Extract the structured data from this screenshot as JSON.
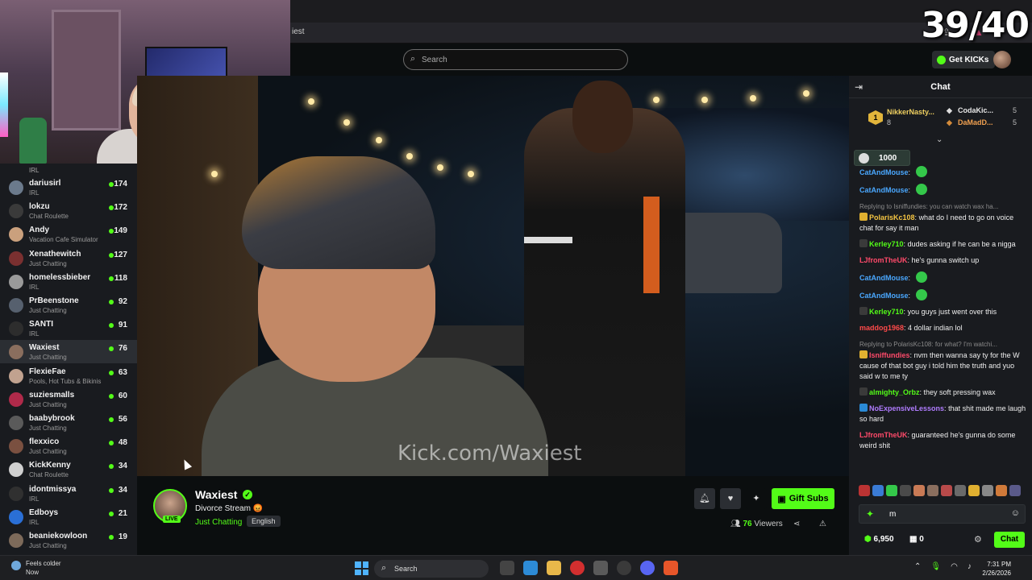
{
  "browser": {
    "address_text": "iest",
    "overlay_counter": "39/40"
  },
  "header": {
    "search_placeholder": "Search",
    "get_kicks_label": "Get KICKs"
  },
  "sidebar": {
    "top_partial_category": "IRL",
    "items": [
      {
        "name": "dariusirl",
        "category": "IRL",
        "viewers": "174",
        "avatar_color": "#6b7a8c"
      },
      {
        "name": "lokzu",
        "category": "Chat Roulette",
        "viewers": "172",
        "avatar_color": "#3a3a3a"
      },
      {
        "name": "Andy",
        "category": "Vacation Cafe Simulator",
        "viewers": "149",
        "avatar_color": "#caa07d"
      },
      {
        "name": "Xenathewitch",
        "category": "Just Chatting",
        "viewers": "127",
        "avatar_color": "#7a3030"
      },
      {
        "name": "homelessbieber",
        "category": "IRL",
        "viewers": "118",
        "avatar_color": "#9a9a9a"
      },
      {
        "name": "PrBeenstone",
        "category": "Just Chatting",
        "viewers": "92",
        "avatar_color": "#56606e"
      },
      {
        "name": "SANTI",
        "category": "IRL",
        "viewers": "91",
        "avatar_color": "#2d2d2d"
      },
      {
        "name": "Waxiest",
        "category": "Just Chatting",
        "viewers": "76",
        "avatar_color": "#8a6e5e",
        "active": true
      },
      {
        "name": "FlexieFae",
        "category": "Pools, Hot Tubs & Bikinis",
        "viewers": "63",
        "avatar_color": "#c1a28f"
      },
      {
        "name": "suziesmalls",
        "category": "Just Chatting",
        "viewers": "60",
        "avatar_color": "#b02a4a"
      },
      {
        "name": "baabybrook",
        "category": "Just Chatting",
        "viewers": "56",
        "avatar_color": "#5a5a5a"
      },
      {
        "name": "flexxico",
        "category": "Just Chatting",
        "viewers": "48",
        "avatar_color": "#7a5040"
      },
      {
        "name": "KickKenny",
        "category": "Chat Roulette",
        "viewers": "34",
        "avatar_color": "#d0d0d0"
      },
      {
        "name": "idontmissya",
        "category": "IRL",
        "viewers": "34",
        "avatar_color": "#303030"
      },
      {
        "name": "Edboys",
        "category": "IRL",
        "viewers": "21",
        "avatar_color": "#2a6fd6"
      },
      {
        "name": "beaniekowloon",
        "category": "Just Chatting",
        "viewers": "19",
        "avatar_color": "#7d6a5a"
      }
    ]
  },
  "video": {
    "watermark": "Kick.com/Waxiest"
  },
  "channel": {
    "name": "Waxiest",
    "live_badge": "LIVE",
    "stream_title": "Divorce Stream 😡",
    "category": "Just Chatting",
    "language": "English",
    "gift_subs_label": "Gift Subs",
    "viewer_count": "76",
    "viewers_label": "Viewers"
  },
  "chat": {
    "title": "Chat",
    "leaderboard": {
      "first": {
        "rank": "1",
        "name": "NikkerNasty...",
        "count": "8"
      },
      "second": {
        "name": "CodaKic...",
        "count": "5"
      },
      "third": {
        "name": "DaMadD...",
        "count": "5"
      }
    },
    "goal_value": "1000",
    "messages": [
      {
        "kind": "msg",
        "user": "CatAndMouse",
        "color": "#4aa8ff",
        "text": "",
        "emote": true
      },
      {
        "kind": "msg",
        "user": "CatAndMouse",
        "color": "#4aa8ff",
        "text": "",
        "emote": true
      },
      {
        "kind": "reply",
        "text": "Replying to Isniffundies: you can watch wax ha..."
      },
      {
        "kind": "msg",
        "user": "PolarisKc108",
        "color": "#f5c542",
        "text": "what do I need to go on voice chat for say it man",
        "badge": "#e0b030"
      },
      {
        "kind": "msg",
        "user": "Kerley710",
        "color": "#53fc18",
        "text": "dudes asking if he can be a nigga",
        "badge": "#3a3a3a"
      },
      {
        "kind": "msg",
        "user": "LJfromTheUK",
        "color": "#ff4a6a",
        "text": "he's gunna switch up"
      },
      {
        "kind": "msg",
        "user": "CatAndMouse",
        "color": "#4aa8ff",
        "text": "",
        "emote": true
      },
      {
        "kind": "msg",
        "user": "CatAndMouse",
        "color": "#4aa8ff",
        "text": "",
        "emote": true
      },
      {
        "kind": "msg",
        "user": "Kerley710",
        "color": "#53fc18",
        "text": "you guys just went over this",
        "badge": "#3a3a3a"
      },
      {
        "kind": "msg",
        "user": "maddog1968",
        "color": "#ff4a4a",
        "text": "4 dollar indian lol"
      },
      {
        "kind": "reply",
        "text": "Replying to PolarisKc108: for what? I'm watchi..."
      },
      {
        "kind": "msg",
        "user": "Isniffundies",
        "color": "#ff4a6a",
        "text": "nvm then wanna say ty for the W cause of that bot guy i told him the truth and yuo said w to me ty",
        "badge": "#e0b030"
      },
      {
        "kind": "msg",
        "user": "almighty_Orbz",
        "color": "#53fc18",
        "text": "they soft pressing wax",
        "badge": "#3a3a3a"
      },
      {
        "kind": "msg",
        "user": "NoExpensiveLessons",
        "color": "#b07cff",
        "text": "that shit made me laugh so hard",
        "badge": "#2a8ad6"
      },
      {
        "kind": "msg",
        "user": "LJfromTheUK",
        "color": "#ff4a6a",
        "text": "guaranteed he's gunna do some weird shit"
      }
    ],
    "input_value": "m",
    "points": "6,950",
    "crates": "0",
    "send_label": "Chat"
  },
  "taskbar": {
    "weather_line1": "Feels colder",
    "weather_line2": "Now",
    "search_label": "Search",
    "time": "7:31 PM",
    "date": "2/26/2026"
  }
}
